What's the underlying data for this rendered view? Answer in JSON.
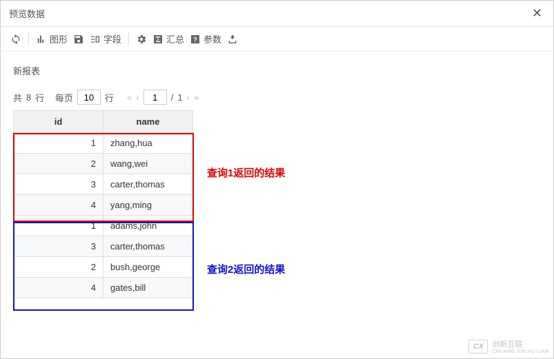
{
  "title": "预览数据",
  "toolbar": {
    "refresh": "",
    "chart": "图形",
    "save": "",
    "fields": "字段",
    "settings": "",
    "summary": "汇总",
    "params": "参数",
    "export": ""
  },
  "subtitle": "新报表",
  "pager": {
    "total_prefix": "共",
    "total_rows": "8",
    "total_suffix": "行",
    "perpage_prefix": "每页",
    "perpage_value": "10",
    "perpage_suffix": "行",
    "page_value": "1",
    "page_sep": "/",
    "page_total": "1"
  },
  "columns": {
    "id": "id",
    "name": "name"
  },
  "rows": [
    {
      "id": "1",
      "name": "zhang,hua"
    },
    {
      "id": "2",
      "name": "wang,wei"
    },
    {
      "id": "3",
      "name": "carter,thomas"
    },
    {
      "id": "4",
      "name": "yang,ming"
    },
    {
      "id": "1",
      "name": "adams,john"
    },
    {
      "id": "3",
      "name": "carter,thomas"
    },
    {
      "id": "2",
      "name": "bush,george"
    },
    {
      "id": "4",
      "name": "gates,bill"
    }
  ],
  "annotations": {
    "query1": "查询1返回的结果",
    "query2": "查询2返回的结果"
  },
  "watermark": {
    "brand": "创新互联",
    "sub": "CHUANG XIN HU LIAN"
  }
}
